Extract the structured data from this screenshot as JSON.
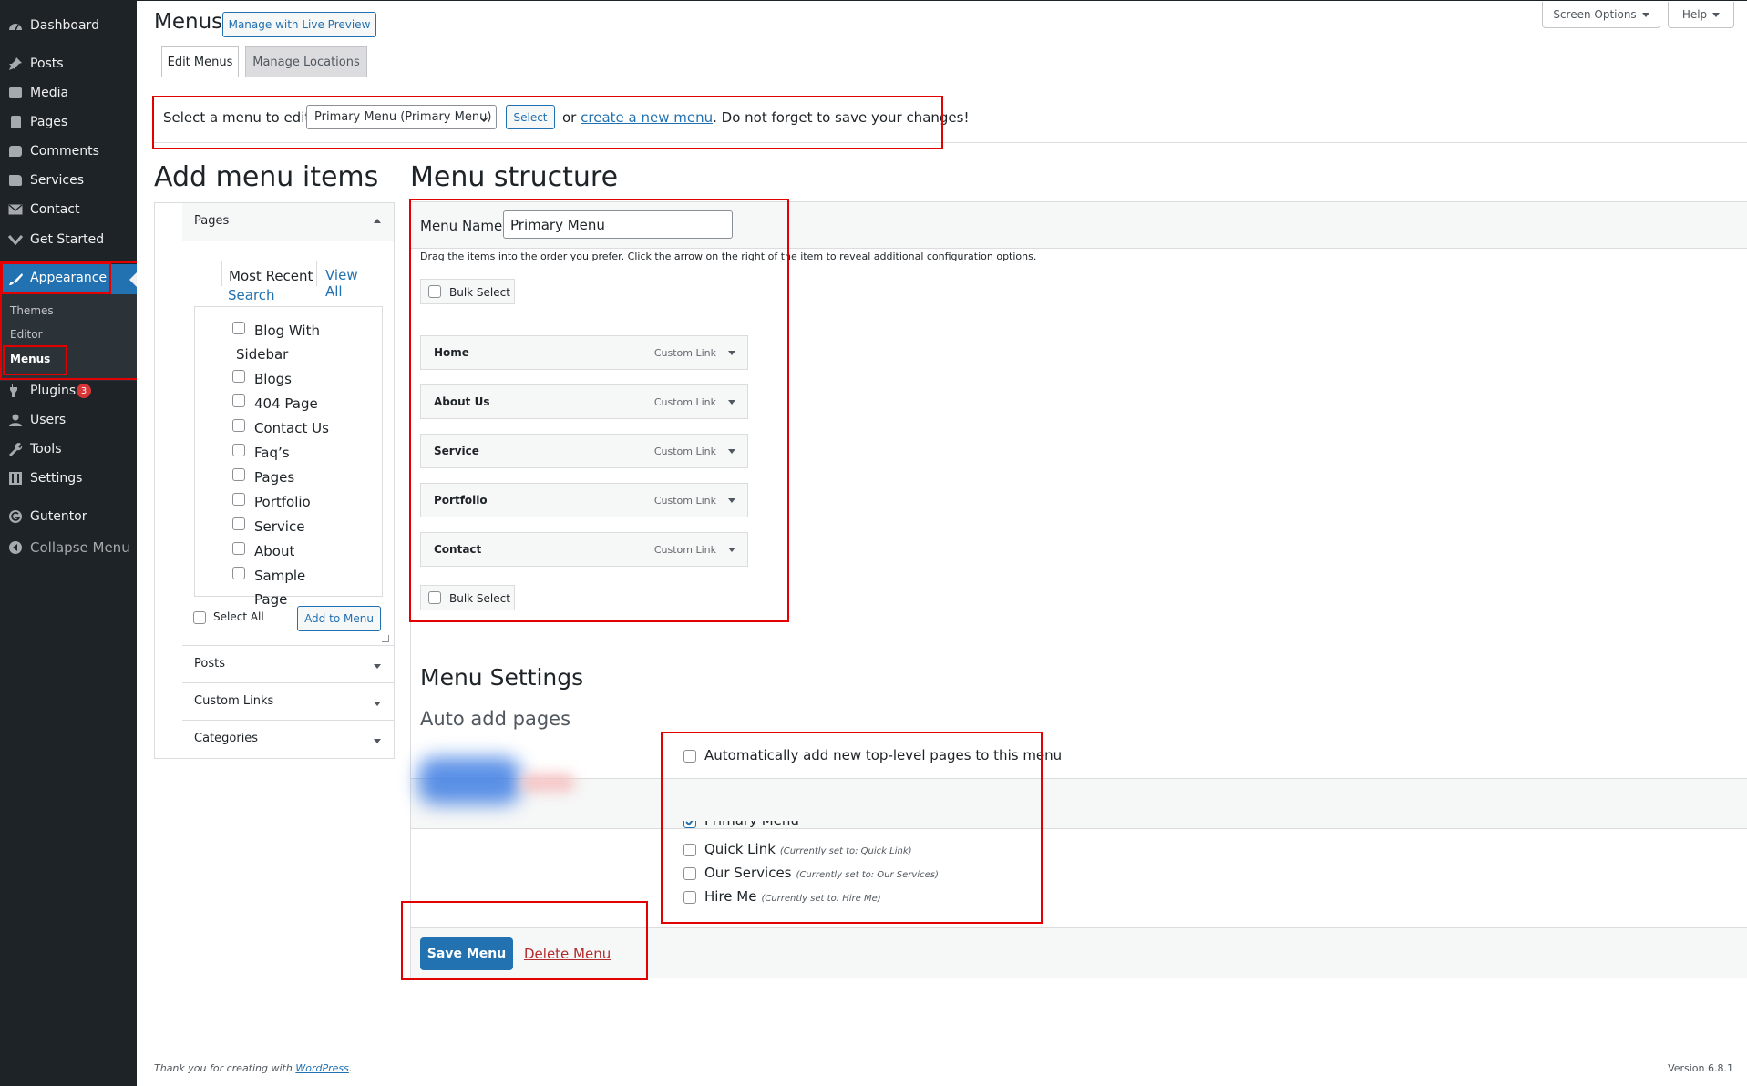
{
  "sidebar": {
    "items": [
      {
        "label": "Dashboard",
        "icon": "dashboard-icon"
      },
      {
        "label": "Posts",
        "icon": "pin-icon"
      },
      {
        "label": "Media",
        "icon": "media-icon"
      },
      {
        "label": "Pages",
        "icon": "pages-icon"
      },
      {
        "label": "Comments",
        "icon": "comment-icon"
      },
      {
        "label": "Services",
        "icon": "folder-icon"
      },
      {
        "label": "Contact",
        "icon": "mail-icon"
      },
      {
        "label": "Get Started",
        "icon": "chevron-down-icon"
      }
    ],
    "appearance": {
      "label": "Appearance",
      "icon": "paintbrush-icon"
    },
    "submenu": [
      "Themes",
      "Editor",
      "Menus"
    ],
    "after": [
      {
        "label": "Plugins",
        "icon": "plugin-icon",
        "badge": "3"
      },
      {
        "label": "Users",
        "icon": "user-icon"
      },
      {
        "label": "Tools",
        "icon": "wrench-icon"
      },
      {
        "label": "Settings",
        "icon": "settings-icon"
      }
    ],
    "gutentor": {
      "label": "Gutentor",
      "icon": "gutentor-icon"
    },
    "collapse": {
      "label": "Collapse Menu",
      "icon": "collapse-icon"
    }
  },
  "header": {
    "title": "Menus",
    "live_preview": "Manage with Live Preview",
    "screen_options": "Screen Options",
    "help": "Help"
  },
  "tabs": {
    "edit": "Edit Menus",
    "locations": "Manage Locations"
  },
  "select_bar": {
    "label": "Select a menu to edit:",
    "selected": "Primary Menu (Primary Menu)",
    "select_btn": "Select",
    "or": "or",
    "create_link": "create a new menu",
    "suffix": ". Do not forget to save your changes!"
  },
  "add_items": {
    "title": "Add menu items",
    "pages_heading": "Pages",
    "tabs": [
      "Most Recent",
      "View All",
      "Search"
    ],
    "pages": [
      "Blog With Sidebar",
      "Blogs",
      "404 Page",
      "Contact Us",
      "Faq’s",
      "Pages",
      "Portfolio",
      "Service",
      "About",
      "Sample Page"
    ],
    "select_all": "Select All",
    "add_btn": "Add to Menu",
    "sections": [
      "Posts",
      "Custom Links",
      "Categories"
    ]
  },
  "structure": {
    "title": "Menu structure",
    "name_label": "Menu Name",
    "name_value": "Primary Menu",
    "instructions": "Drag the items into the order you prefer. Click the arrow on the right of the item to reveal additional configuration options.",
    "bulk": "Bulk Select",
    "items": [
      {
        "title": "Home",
        "type": "Custom Link"
      },
      {
        "title": "About Us",
        "type": "Custom Link"
      },
      {
        "title": "Service",
        "type": "Custom Link"
      },
      {
        "title": "Portfolio",
        "type": "Custom Link"
      },
      {
        "title": "Contact",
        "type": "Custom Link"
      }
    ]
  },
  "settings": {
    "title": "Menu Settings",
    "auto_add": "Auto add pages",
    "auto_add_label": "Automatically add new top-level pages to this menu",
    "locations": [
      {
        "name": "Primary Menu",
        "note": "",
        "checked": true
      },
      {
        "name": "Quick Link",
        "note": "(Currently set to: Quick Link)",
        "checked": false
      },
      {
        "name": "Our Services",
        "note": "(Currently set to: Our Services)",
        "checked": false
      },
      {
        "name": "Hire Me",
        "note": "(Currently set to: Hire Me)",
        "checked": false
      }
    ]
  },
  "footer_actions": {
    "save": "Save Menu",
    "delete": "Delete Menu"
  },
  "footer": {
    "thanks": "Thank you for creating with",
    "wp": "WordPress",
    "dot": ".",
    "version": "Version 6.8.1"
  },
  "colors": {
    "accent": "#2271b1",
    "sidebar": "#1d2327",
    "highlight": "#e20000",
    "delete": "#b32d2e",
    "badge": "#d63638"
  }
}
